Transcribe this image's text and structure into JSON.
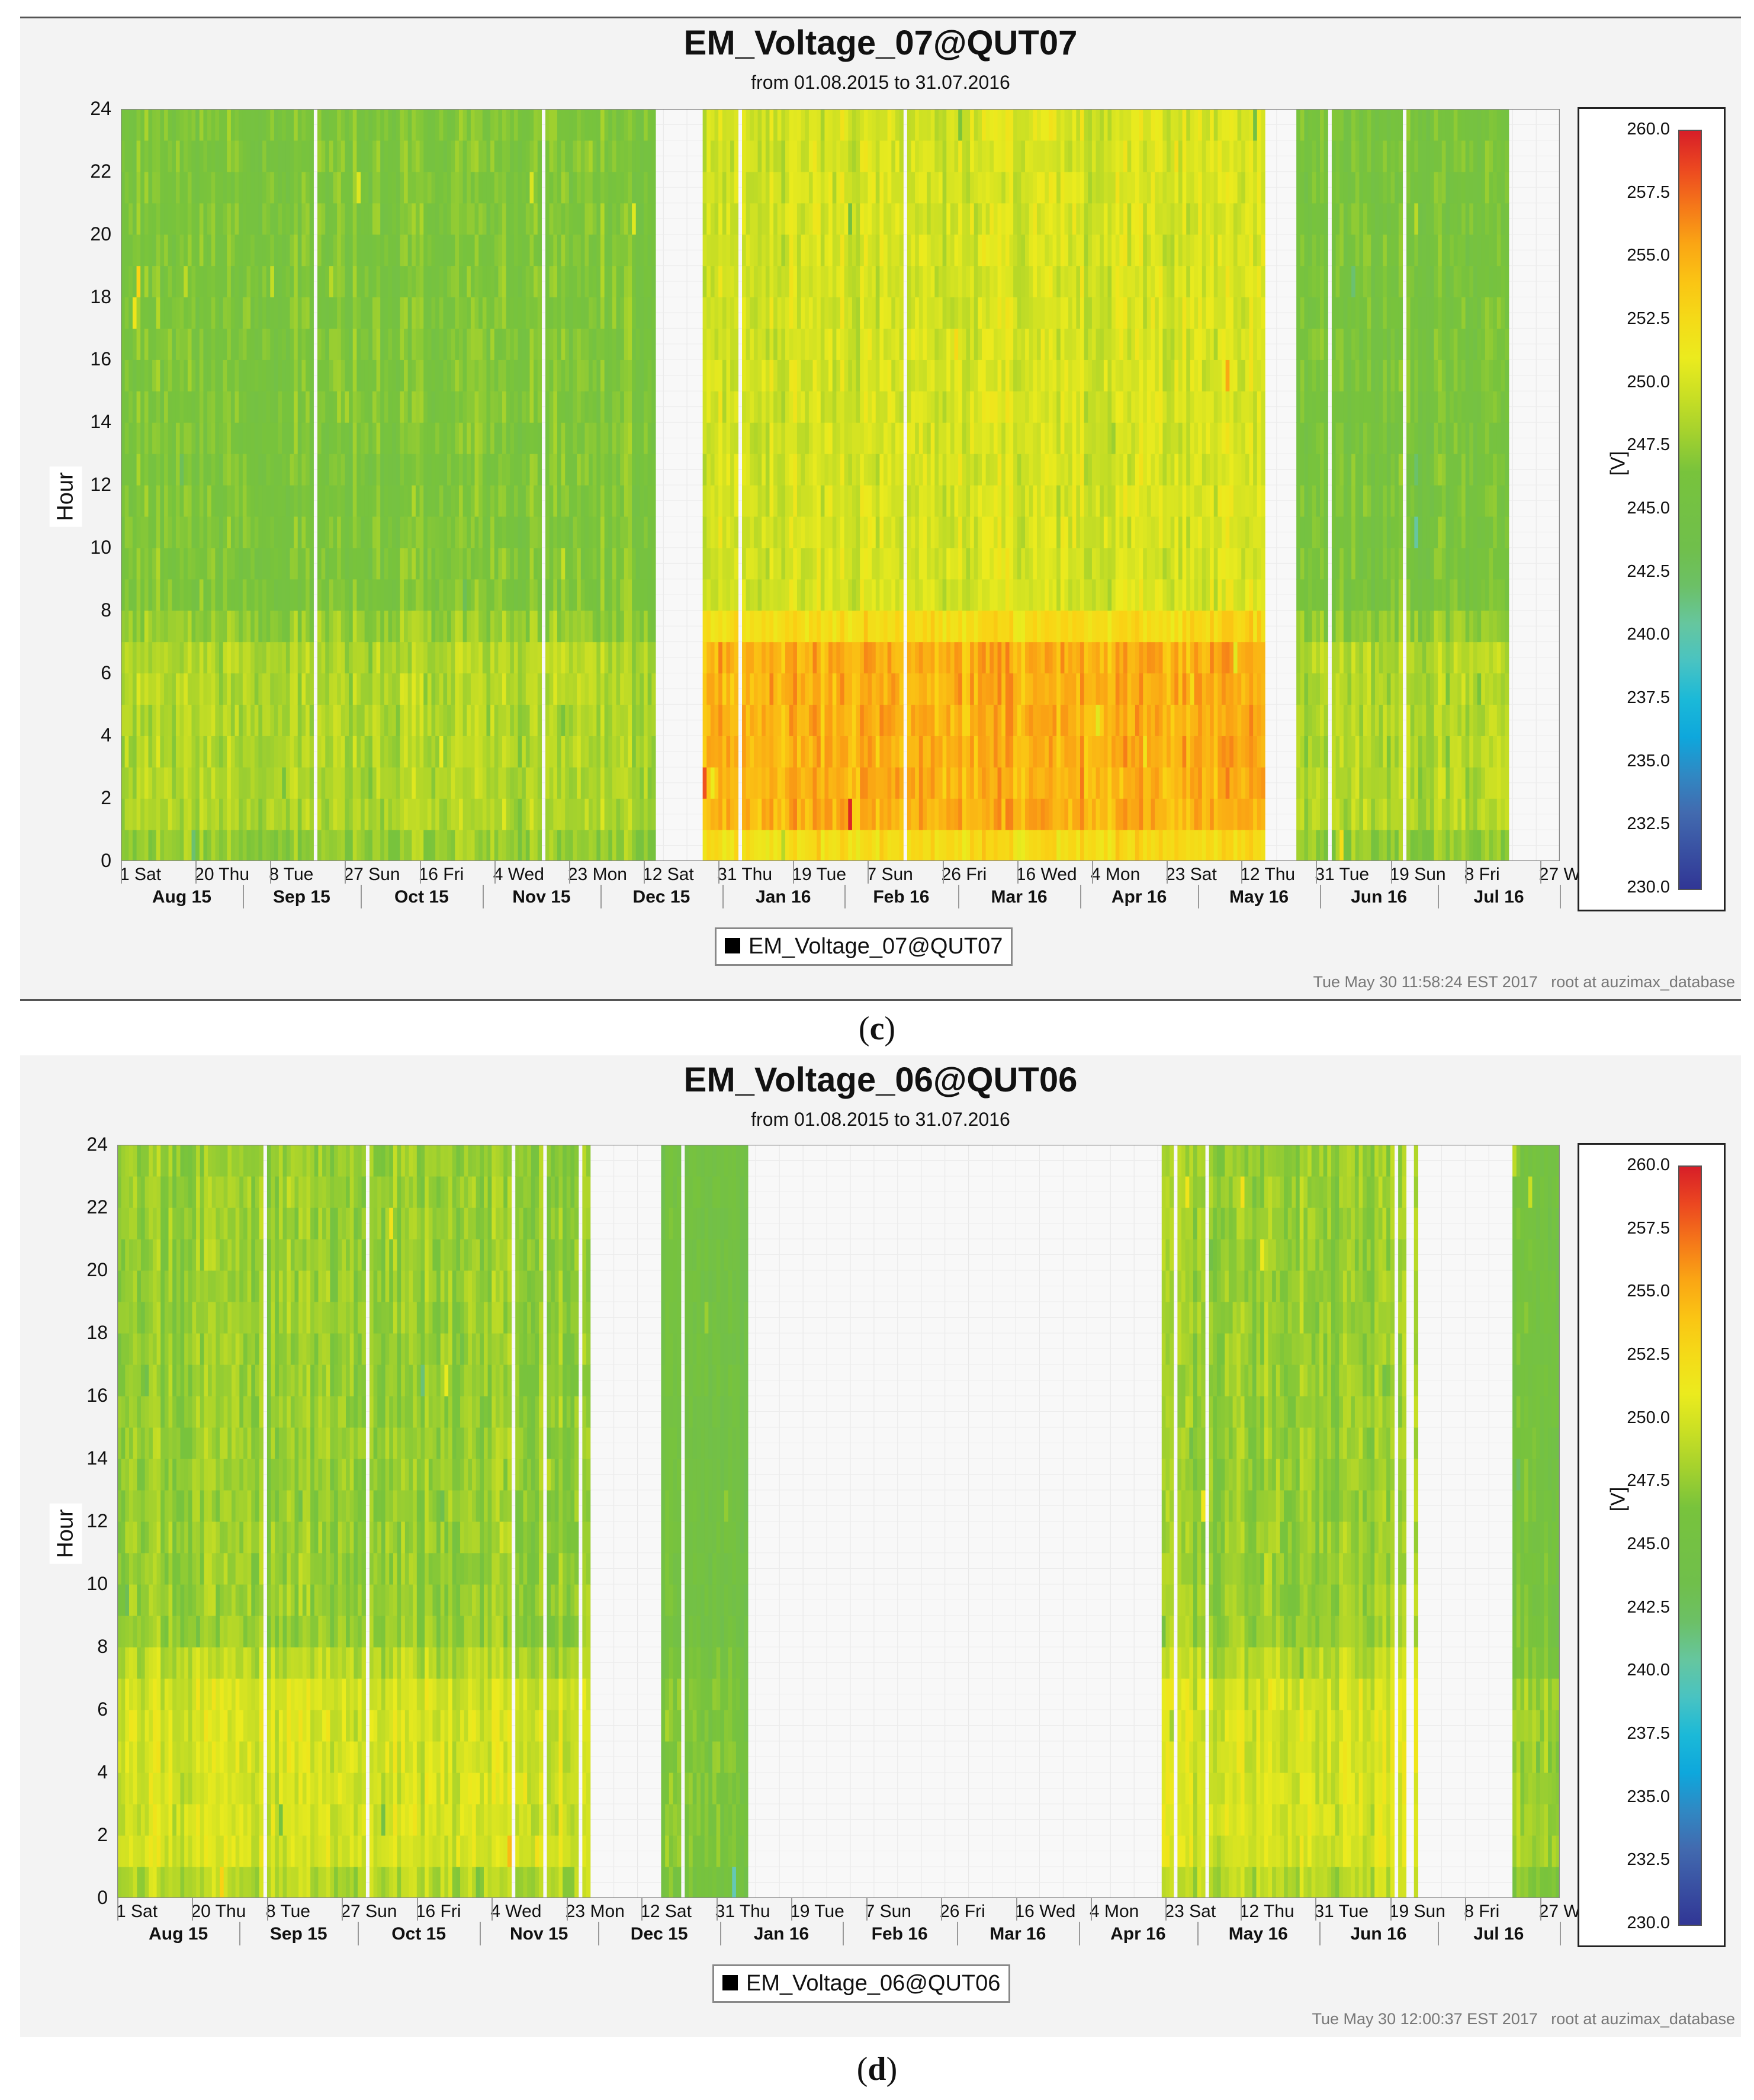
{
  "chart_data": [
    {
      "type": "heatmap",
      "title": "EM_Voltage_07@QUT07",
      "subtitle": "from 01.08.2015 to 31.07.2016",
      "xlabel": "",
      "ylabel": "Hour",
      "ylim": [
        0,
        24
      ],
      "yticks": [
        "0",
        "2",
        "4",
        "6",
        "8",
        "10",
        "12",
        "14",
        "16",
        "18",
        "20",
        "22",
        "24"
      ],
      "xlim": [
        "01.08.2015",
        "31.07.2016"
      ],
      "x_day_ticks": [
        "1 Sat",
        "20 Thu",
        "8 Tue",
        "27 Sun",
        "16 Fri",
        "4 Wed",
        "23 Mon",
        "12 Sat",
        "31 Thu",
        "19 Tue",
        "7 Sun",
        "26 Fri",
        "16 Wed",
        "4 Mon",
        "23 Sat",
        "12 Thu",
        "31 Tue",
        "19 Sun",
        "8 Fri",
        "27 Wed"
      ],
      "x_month_ticks": [
        "Aug 15",
        "Sep 15",
        "Oct 15",
        "Nov 15",
        "Dec 15",
        "Jan 16",
        "Feb 16",
        "Mar 16",
        "Apr 16",
        "May 16",
        "Jun 16",
        "Jul 16"
      ],
      "colorbar": {
        "label": "[V]",
        "min": 230.0,
        "max": 260.0,
        "ticks": [
          "260.0",
          "257.5",
          "255.0",
          "252.5",
          "250.0",
          "247.5",
          "245.0",
          "242.5",
          "240.0",
          "237.5",
          "235.0",
          "232.5",
          "230.0"
        ]
      },
      "legend": [
        "EM_Voltage_07@QUT07"
      ],
      "legend_position": "bottom-center",
      "data_gaps_day_of_record": [
        [
          136,
          148
        ],
        [
          291,
          299
        ],
        [
          310,
          312
        ],
        [
          353,
          366
        ]
      ],
      "regions": [
        {
          "days": [
            0,
            136
          ],
          "hours": [
            0,
            24
          ],
          "typical_V": 246.5,
          "night_peak_V": 248.5
        },
        {
          "days": [
            148,
            291
          ],
          "hours": [
            0,
            24
          ],
          "typical_V": 250.0,
          "night_peak_V": 255.0
        },
        {
          "days": [
            299,
            353
          ],
          "hours": [
            0,
            24
          ],
          "typical_V": 246.0,
          "night_peak_V": 248.5
        }
      ],
      "footer_timestamp": "Tue May 30 11:58:24 EST 2017",
      "footer_user": "root at auzimax_database"
    },
    {
      "type": "heatmap",
      "title": "EM_Voltage_06@QUT06",
      "subtitle": "from 01.08.2015 to 31.07.2016",
      "xlabel": "",
      "ylabel": "Hour",
      "ylim": [
        0,
        24
      ],
      "yticks": [
        "0",
        "2",
        "4",
        "6",
        "8",
        "10",
        "12",
        "14",
        "16",
        "18",
        "20",
        "22",
        "24"
      ],
      "xlim": [
        "01.08.2015",
        "31.07.2016"
      ],
      "x_day_ticks": [
        "1 Sat",
        "20 Thu",
        "8 Tue",
        "27 Sun",
        "16 Fri",
        "4 Wed",
        "23 Mon",
        "12 Sat",
        "31 Thu",
        "19 Tue",
        "7 Sun",
        "26 Fri",
        "16 Wed",
        "4 Mon",
        "23 Sat",
        "12 Thu",
        "31 Tue",
        "19 Sun",
        "8 Fri",
        "27 Wed"
      ],
      "x_month_ticks": [
        "Aug 15",
        "Sep 15",
        "Oct 15",
        "Nov 15",
        "Dec 15",
        "Jan 16",
        "Feb 16",
        "Mar 16",
        "Apr 16",
        "May 16",
        "Jun 16",
        "Jul 16"
      ],
      "colorbar": {
        "label": "[V]",
        "min": 230.0,
        "max": 260.0,
        "ticks": [
          "260.0",
          "257.5",
          "255.0",
          "252.5",
          "250.0",
          "247.5",
          "245.0",
          "242.5",
          "240.0",
          "237.5",
          "235.0",
          "232.5",
          "230.0"
        ]
      },
      "legend": [
        "EM_Voltage_06@QUT06"
      ],
      "legend_position": "bottom-center",
      "data_gaps_day_of_record": [
        [
          120,
          138
        ],
        [
          160,
          265
        ],
        [
          330,
          354
        ]
      ],
      "regions": [
        {
          "days": [
            0,
            120
          ],
          "hours": [
            0,
            24
          ],
          "typical_V": 247.5,
          "night_peak_V": 250.0
        },
        {
          "days": [
            138,
            160
          ],
          "hours": [
            0,
            24
          ],
          "typical_V": 245.0,
          "night_peak_V": 246.5
        },
        {
          "days": [
            265,
            330
          ],
          "hours": [
            0,
            24
          ],
          "typical_V": 247.5,
          "night_peak_V": 250.0
        },
        {
          "days": [
            354,
            366
          ],
          "hours": [
            0,
            24
          ],
          "typical_V": 245.5,
          "night_peak_V": 247.5
        }
      ],
      "footer_timestamp": "Tue May 30 12:00:37 EST 2017",
      "footer_user": "root at auzimax_database"
    }
  ],
  "captions": [
    {
      "open": "(",
      "letter": "c",
      "close": ")"
    },
    {
      "open": "(",
      "letter": "d",
      "close": ")"
    }
  ]
}
